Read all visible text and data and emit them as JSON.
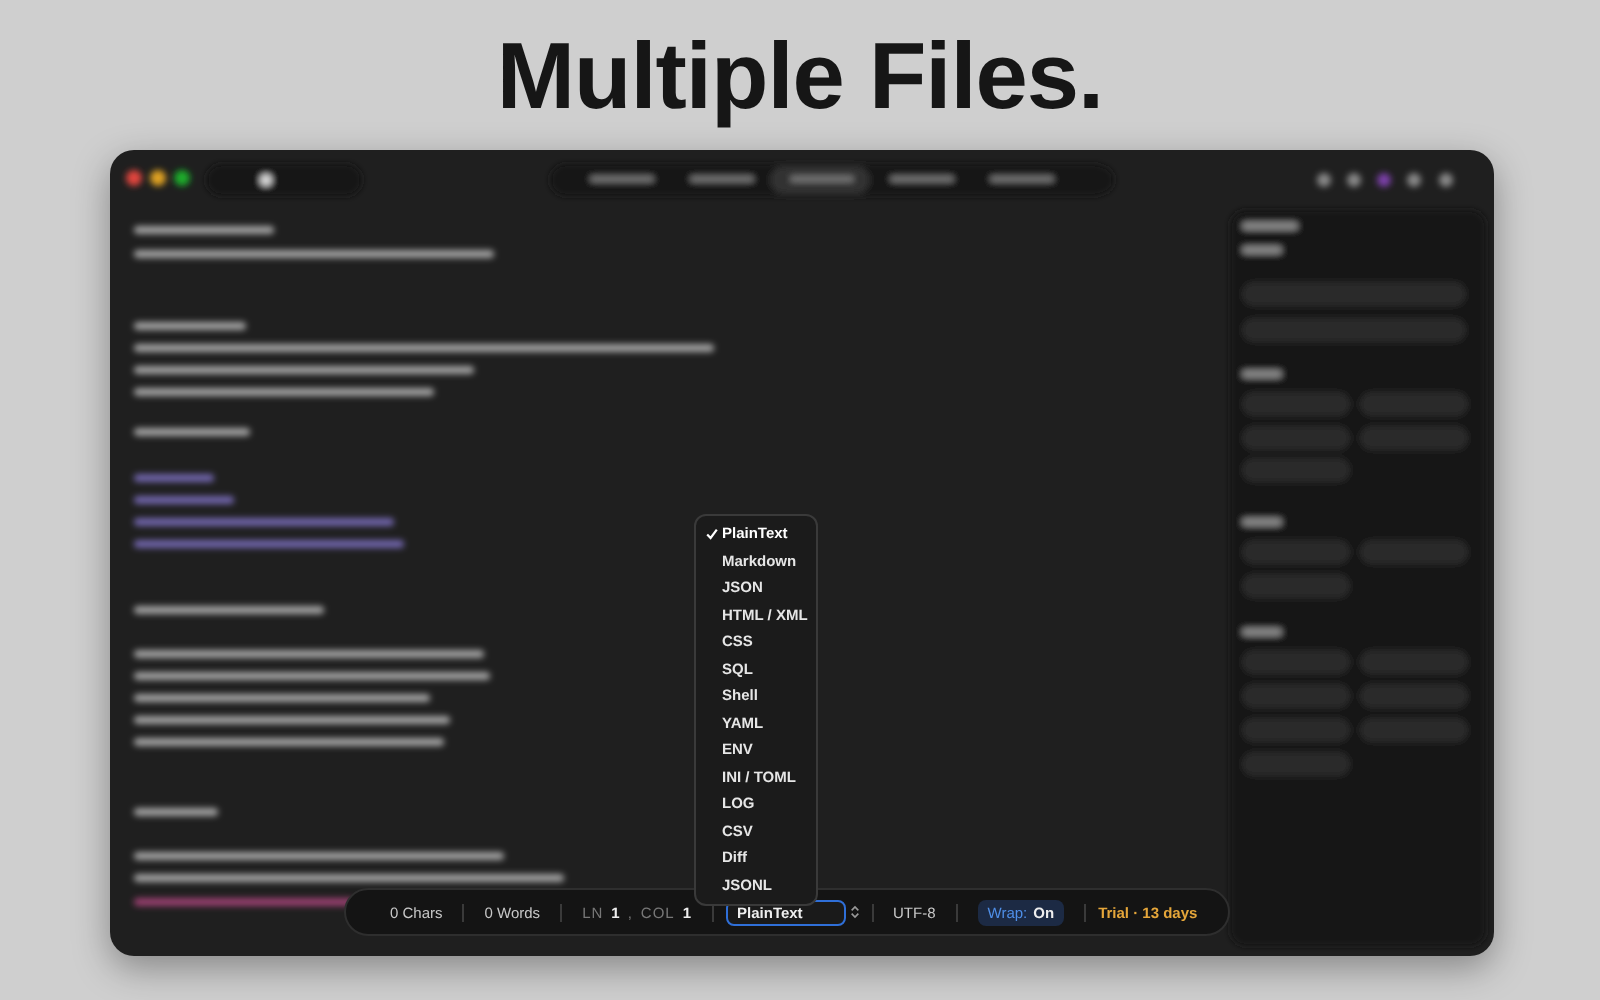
{
  "headline": "Multiple Files.",
  "language_menu": {
    "items": [
      {
        "label": "PlainText",
        "selected": true
      },
      {
        "label": "Markdown",
        "selected": false
      },
      {
        "label": "JSON",
        "selected": false
      },
      {
        "label": "HTML / XML",
        "selected": false
      },
      {
        "label": "CSS",
        "selected": false
      },
      {
        "label": "SQL",
        "selected": false
      },
      {
        "label": "Shell",
        "selected": false
      },
      {
        "label": "YAML",
        "selected": false
      },
      {
        "label": "ENV",
        "selected": false
      },
      {
        "label": "INI / TOML",
        "selected": false
      },
      {
        "label": "LOG",
        "selected": false
      },
      {
        "label": "CSV",
        "selected": false
      },
      {
        "label": "Diff",
        "selected": false
      },
      {
        "label": "JSONL",
        "selected": false
      }
    ]
  },
  "status_bar": {
    "chars": "0 Chars",
    "words": "0 Words",
    "line_label": "LN",
    "line": "1",
    "separator": ",",
    "col_label": "COL",
    "col": "1",
    "language": "PlainText",
    "encoding": "UTF-8",
    "wrap_label": "Wrap:",
    "wrap_value": "On",
    "trial": "Trial · 13 days"
  }
}
